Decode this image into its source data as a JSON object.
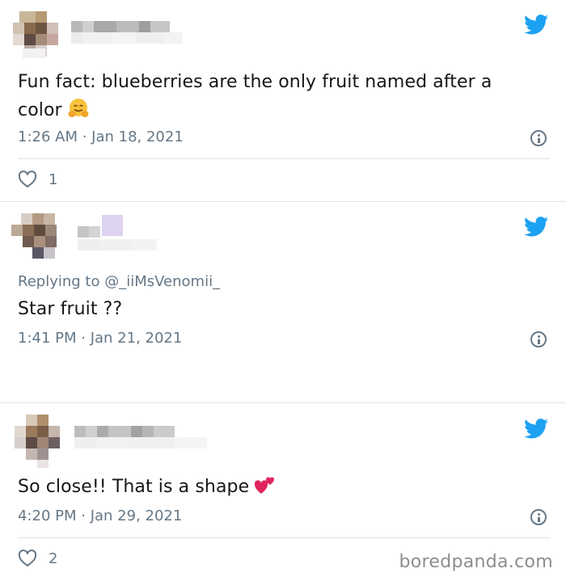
{
  "tweets": [
    {
      "text": "Fun fact: blueberries are the only fruit named after a color",
      "emoji": "hugging-face",
      "time": "1:26 AM · Jan 18, 2021",
      "likes": "1"
    },
    {
      "replying_prefix": "Replying to",
      "replying_handle": "@_iiMsVenomii_",
      "text": "Star fruit ??",
      "time": "1:41 PM · Jan 21, 2021"
    },
    {
      "text": "So close!! That is a shape",
      "emoji": "two-hearts",
      "time": "4:20 PM · Jan 29, 2021",
      "likes": "2"
    }
  ],
  "watermark": "boredpanda.com",
  "colors": {
    "twitter_blue": "#1da1f2",
    "meta_gray": "#657786",
    "divider": "#dde3e8"
  }
}
